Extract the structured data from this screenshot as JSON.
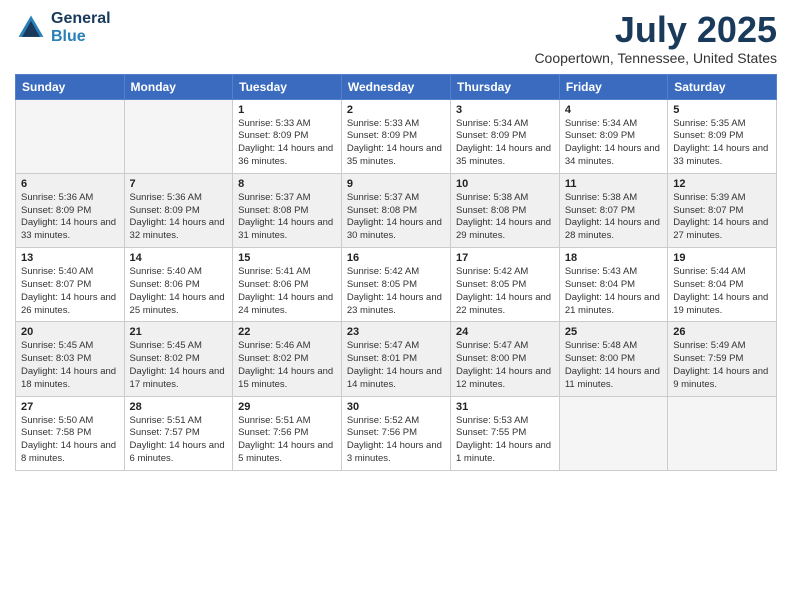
{
  "header": {
    "logo_line1": "General",
    "logo_line2": "Blue",
    "title": "July 2025",
    "subtitle": "Coopertown, Tennessee, United States"
  },
  "weekdays": [
    "Sunday",
    "Monday",
    "Tuesday",
    "Wednesday",
    "Thursday",
    "Friday",
    "Saturday"
  ],
  "weeks": [
    [
      {
        "day": "",
        "empty": true
      },
      {
        "day": "",
        "empty": true
      },
      {
        "day": "1",
        "sunrise": "5:33 AM",
        "sunset": "8:09 PM",
        "daylight": "14 hours and 36 minutes."
      },
      {
        "day": "2",
        "sunrise": "5:33 AM",
        "sunset": "8:09 PM",
        "daylight": "14 hours and 35 minutes."
      },
      {
        "day": "3",
        "sunrise": "5:34 AM",
        "sunset": "8:09 PM",
        "daylight": "14 hours and 35 minutes."
      },
      {
        "day": "4",
        "sunrise": "5:34 AM",
        "sunset": "8:09 PM",
        "daylight": "14 hours and 34 minutes."
      },
      {
        "day": "5",
        "sunrise": "5:35 AM",
        "sunset": "8:09 PM",
        "daylight": "14 hours and 33 minutes."
      }
    ],
    [
      {
        "day": "6",
        "sunrise": "5:36 AM",
        "sunset": "8:09 PM",
        "daylight": "14 hours and 33 minutes."
      },
      {
        "day": "7",
        "sunrise": "5:36 AM",
        "sunset": "8:09 PM",
        "daylight": "14 hours and 32 minutes."
      },
      {
        "day": "8",
        "sunrise": "5:37 AM",
        "sunset": "8:08 PM",
        "daylight": "14 hours and 31 minutes."
      },
      {
        "day": "9",
        "sunrise": "5:37 AM",
        "sunset": "8:08 PM",
        "daylight": "14 hours and 30 minutes."
      },
      {
        "day": "10",
        "sunrise": "5:38 AM",
        "sunset": "8:08 PM",
        "daylight": "14 hours and 29 minutes."
      },
      {
        "day": "11",
        "sunrise": "5:38 AM",
        "sunset": "8:07 PM",
        "daylight": "14 hours and 28 minutes."
      },
      {
        "day": "12",
        "sunrise": "5:39 AM",
        "sunset": "8:07 PM",
        "daylight": "14 hours and 27 minutes."
      }
    ],
    [
      {
        "day": "13",
        "sunrise": "5:40 AM",
        "sunset": "8:07 PM",
        "daylight": "14 hours and 26 minutes."
      },
      {
        "day": "14",
        "sunrise": "5:40 AM",
        "sunset": "8:06 PM",
        "daylight": "14 hours and 25 minutes."
      },
      {
        "day": "15",
        "sunrise": "5:41 AM",
        "sunset": "8:06 PM",
        "daylight": "14 hours and 24 minutes."
      },
      {
        "day": "16",
        "sunrise": "5:42 AM",
        "sunset": "8:05 PM",
        "daylight": "14 hours and 23 minutes."
      },
      {
        "day": "17",
        "sunrise": "5:42 AM",
        "sunset": "8:05 PM",
        "daylight": "14 hours and 22 minutes."
      },
      {
        "day": "18",
        "sunrise": "5:43 AM",
        "sunset": "8:04 PM",
        "daylight": "14 hours and 21 minutes."
      },
      {
        "day": "19",
        "sunrise": "5:44 AM",
        "sunset": "8:04 PM",
        "daylight": "14 hours and 19 minutes."
      }
    ],
    [
      {
        "day": "20",
        "sunrise": "5:45 AM",
        "sunset": "8:03 PM",
        "daylight": "14 hours and 18 minutes."
      },
      {
        "day": "21",
        "sunrise": "5:45 AM",
        "sunset": "8:02 PM",
        "daylight": "14 hours and 17 minutes."
      },
      {
        "day": "22",
        "sunrise": "5:46 AM",
        "sunset": "8:02 PM",
        "daylight": "14 hours and 15 minutes."
      },
      {
        "day": "23",
        "sunrise": "5:47 AM",
        "sunset": "8:01 PM",
        "daylight": "14 hours and 14 minutes."
      },
      {
        "day": "24",
        "sunrise": "5:47 AM",
        "sunset": "8:00 PM",
        "daylight": "14 hours and 12 minutes."
      },
      {
        "day": "25",
        "sunrise": "5:48 AM",
        "sunset": "8:00 PM",
        "daylight": "14 hours and 11 minutes."
      },
      {
        "day": "26",
        "sunrise": "5:49 AM",
        "sunset": "7:59 PM",
        "daylight": "14 hours and 9 minutes."
      }
    ],
    [
      {
        "day": "27",
        "sunrise": "5:50 AM",
        "sunset": "7:58 PM",
        "daylight": "14 hours and 8 minutes."
      },
      {
        "day": "28",
        "sunrise": "5:51 AM",
        "sunset": "7:57 PM",
        "daylight": "14 hours and 6 minutes."
      },
      {
        "day": "29",
        "sunrise": "5:51 AM",
        "sunset": "7:56 PM",
        "daylight": "14 hours and 5 minutes."
      },
      {
        "day": "30",
        "sunrise": "5:52 AM",
        "sunset": "7:56 PM",
        "daylight": "14 hours and 3 minutes."
      },
      {
        "day": "31",
        "sunrise": "5:53 AM",
        "sunset": "7:55 PM",
        "daylight": "14 hours and 1 minute."
      },
      {
        "day": "",
        "empty": true
      },
      {
        "day": "",
        "empty": true
      }
    ]
  ],
  "labels": {
    "sunrise": "Sunrise:",
    "sunset": "Sunset:",
    "daylight": "Daylight:"
  }
}
